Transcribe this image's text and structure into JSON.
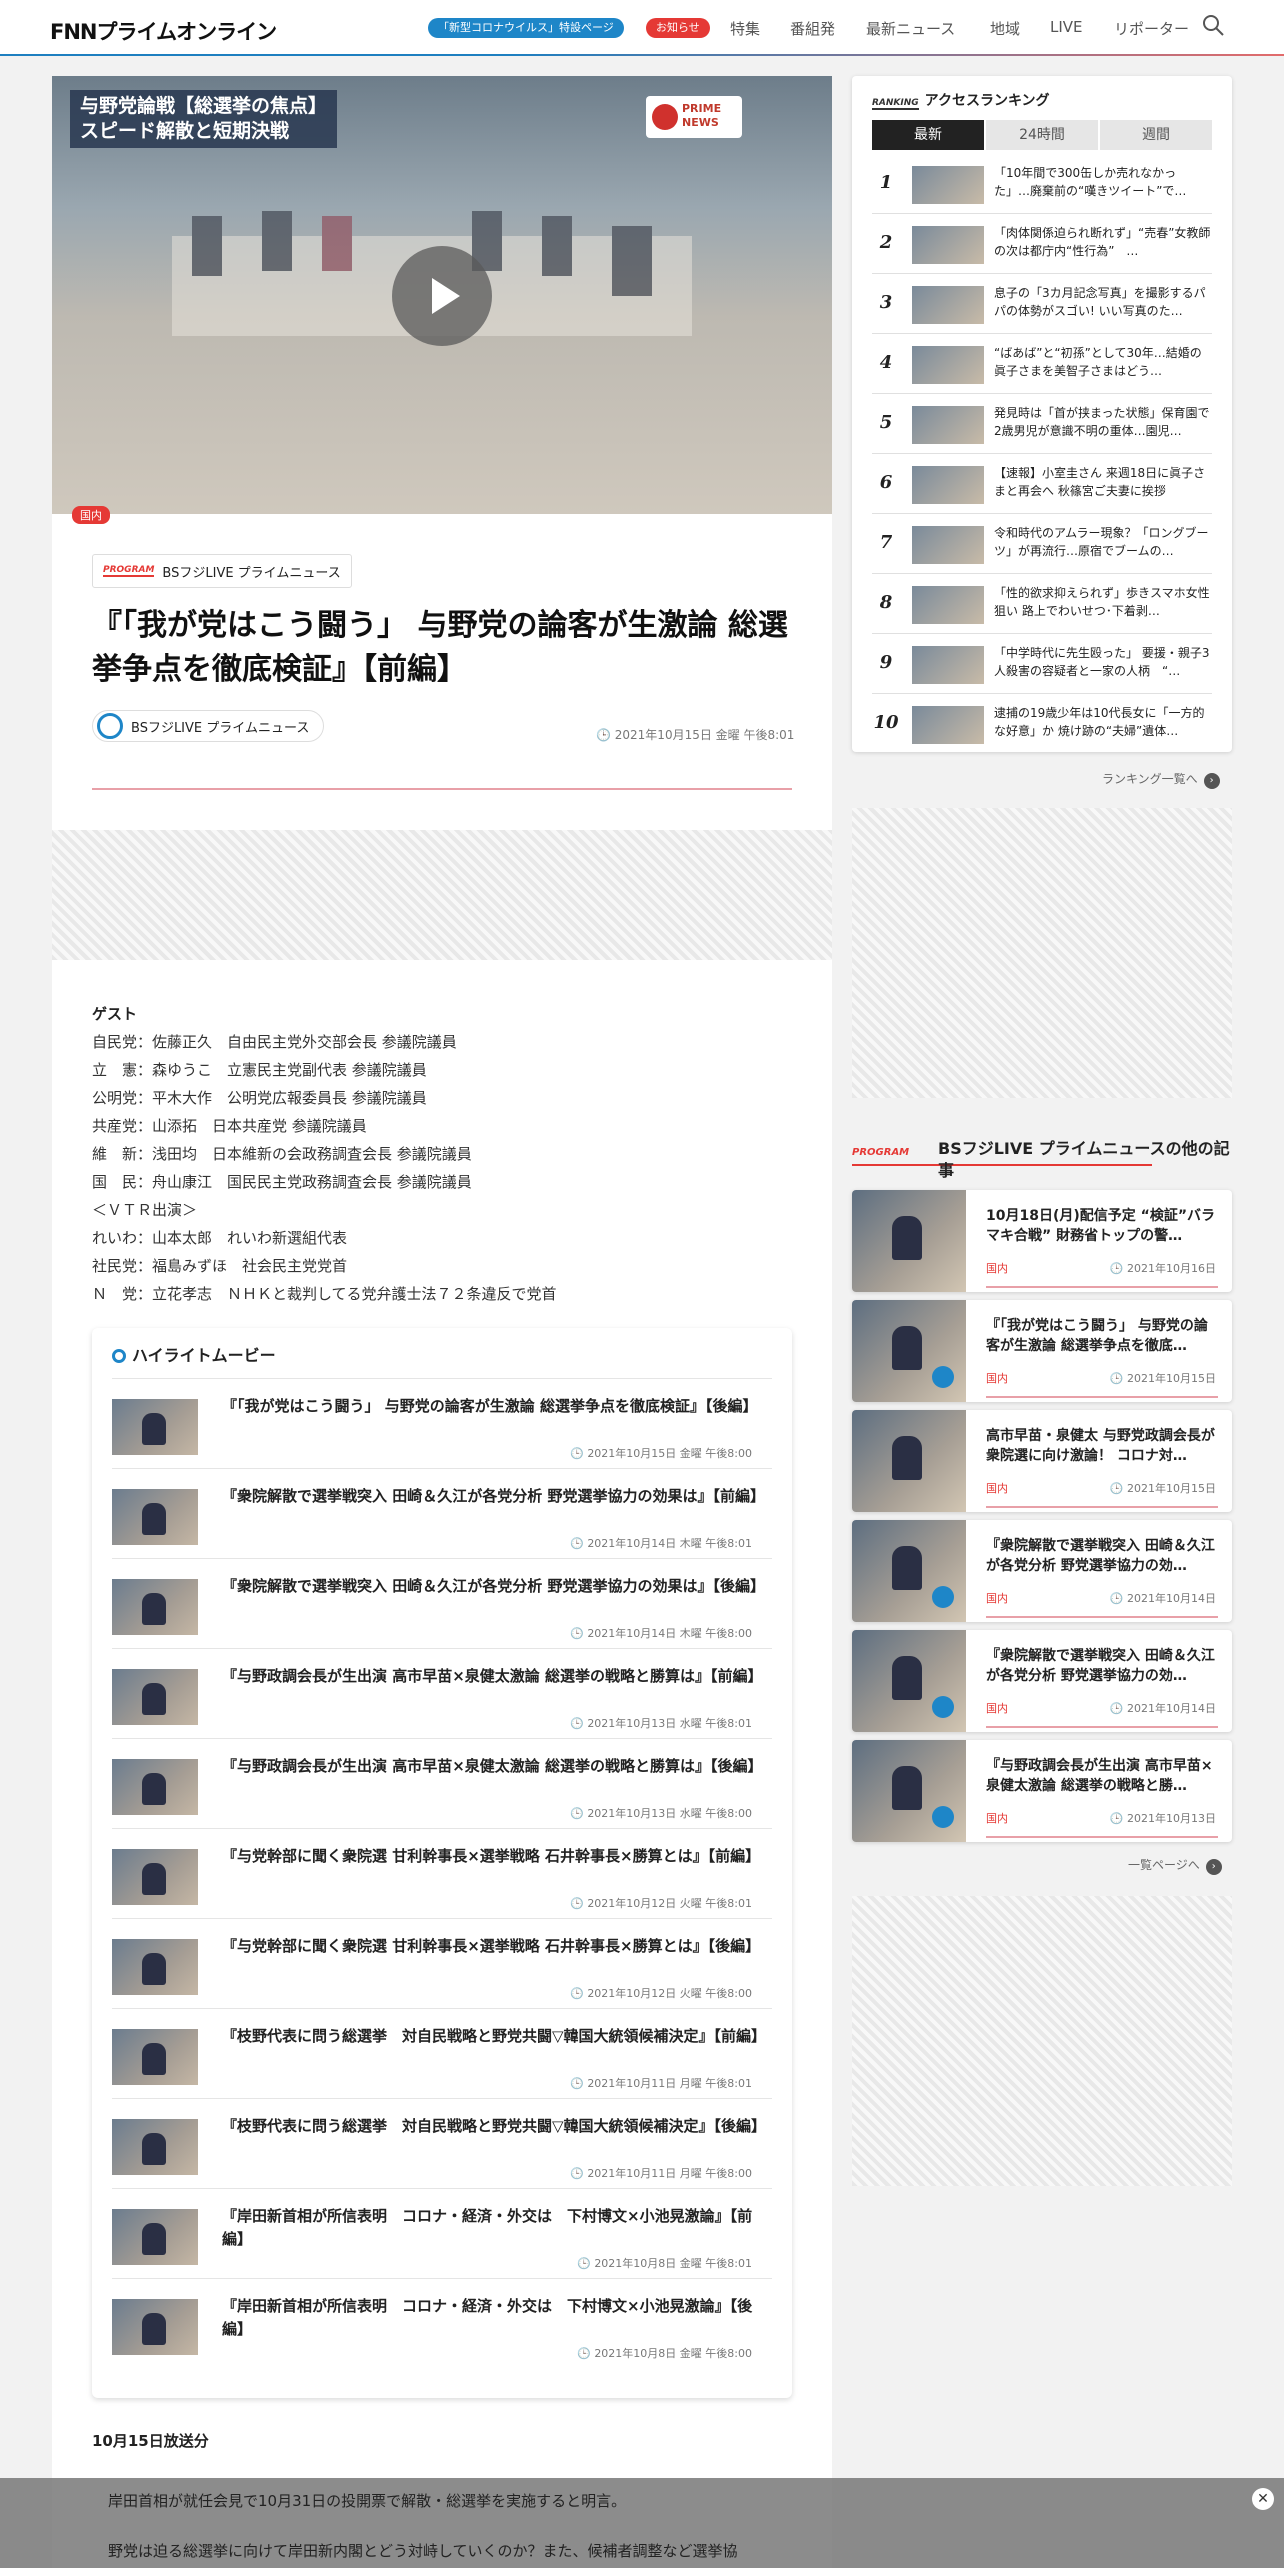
{
  "header": {
    "logo": "FNNプライムオンライン",
    "corona_pill": "「新型コロナウイルス」特設ページ",
    "notice_pill": "お知らせ",
    "nav": [
      "特集",
      "番組発",
      "最新ニュース",
      "地域",
      "LIVE",
      "リポーター"
    ]
  },
  "hero": {
    "caption_line1": "与野党論戦【総選挙の焦点】",
    "caption_line2": "スピード解散と短期決戦",
    "brand_badge": "PRIME NEWS",
    "category_tag": "国内"
  },
  "article": {
    "program_mark": "PROGRAM",
    "program_name": "BSフジLIVE プライムニュース",
    "title": "『「我が党はこう闘う」 与野党の論客が生激論 総選挙争点を徹底検証』【前編】",
    "author": "BSフジLIVE プライムニュース",
    "date": "2021年10月15日 金曜 午後8:01",
    "guest_heading": "ゲスト",
    "guests": [
      "自民党：佐藤正久　自由民主党外交部会長 参議院議員",
      "立　憲：森ゆうこ　立憲民主党副代表 参議院議員",
      "公明党：平木大作　公明党広報委員長 参議院議員",
      "共産党：山添拓　日本共産党 参議院議員",
      "維　新：浅田均　日本維新の会政務調査会長 参議院議員",
      "国　民：舟山康江　国民民主党政務調査会長 参議院議員",
      "＜ＶＴＲ出演＞",
      "れいわ：山本太郎　れいわ新選組代表",
      "社民党：福島みずほ　社会民主党党首",
      "Ｎ　党：立花孝志　ＮＨＫと裁判してる党弁護士法７２条違反で党首"
    ],
    "broadcast_heading": "10月15日放送分",
    "para1": "岸田首相が就任会見で10月31日の投開票で解散・総選挙を実施すると明言。",
    "para2": "野党は迫る総選挙に向けて岸田新内閣とどう対峙していくのか？また、候補者調整など選挙協"
  },
  "highlight": {
    "heading": "ハイライトムービー",
    "items": [
      {
        "title": "『「我が党はこう闘う」 与野党の論客が生激論 総選挙争点を徹底検証』【後編】",
        "date": "2021年10月15日 金曜 午後8:00"
      },
      {
        "title": "『衆院解散で選挙戦突入 田崎＆久江が各党分析 野党選挙協力の効果は』【前編】",
        "date": "2021年10月14日 木曜 午後8:01"
      },
      {
        "title": "『衆院解散で選挙戦突入 田崎＆久江が各党分析 野党選挙協力の効果は』【後編】",
        "date": "2021年10月14日 木曜 午後8:00"
      },
      {
        "title": "『与野政調会長が生出演 高市早苗×泉健太激論 総選挙の戦略と勝算は』【前編】",
        "date": "2021年10月13日 水曜 午後8:01"
      },
      {
        "title": "『与野政調会長が生出演 高市早苗×泉健太激論 総選挙の戦略と勝算は』【後編】",
        "date": "2021年10月13日 水曜 午後8:00"
      },
      {
        "title": "『与党幹部に聞く衆院選 甘利幹事長×選挙戦略 石井幹事長×勝算とは』【前編】",
        "date": "2021年10月12日 火曜 午後8:01"
      },
      {
        "title": "『与党幹部に聞く衆院選 甘利幹事長×選挙戦略 石井幹事長×勝算とは』【後編】",
        "date": "2021年10月12日 火曜 午後8:00"
      },
      {
        "title": "『枝野代表に問う総選挙　対自民戦略と野党共闘▽韓国大統領候補決定』【前編】",
        "date": "2021年10月11日 月曜 午後8:01"
      },
      {
        "title": "『枝野代表に問う総選挙　対自民戦略と野党共闘▽韓国大統領候補決定』【後編】",
        "date": "2021年10月11日 月曜 午後8:00"
      },
      {
        "title": "『岸田新首相が所信表明　コロナ・経済・外交は　下村博文×小池晃激論』【前編】",
        "date": "2021年10月8日 金曜 午後8:01"
      },
      {
        "title": "『岸田新首相が所信表明　コロナ・経済・外交は　下村博文×小池晃激論』【後編】",
        "date": "2021年10月8日 金曜 午後8:00"
      }
    ]
  },
  "ranking": {
    "mark": "RANKING",
    "heading": "アクセスランキング",
    "tabs": [
      "最新",
      "24時間",
      "週間"
    ],
    "items": [
      {
        "num": "1",
        "title": "「10年間で300缶しか売れなかった」…廃棄前の“嘆きツイート”で…"
      },
      {
        "num": "2",
        "title": "「肉体関係迫られ断れず」“売春”女教師の次は都庁内“性行為”　…"
      },
      {
        "num": "3",
        "title": "息子の「3カ月記念写真」を撮影するパパの体勢がスゴい! いい写真のた…"
      },
      {
        "num": "4",
        "title": "“ばあば”と“初孫”として30年…結婚の眞子さまを美智子さまはどう…"
      },
      {
        "num": "5",
        "title": "発見時は「首が挟まった状態」保育園で2歳男児が意識不明の重体…園児…"
      },
      {
        "num": "6",
        "title": "【速報】小室圭さん 来週18日に眞子さまと再会へ 秋篠宮ご夫妻に挨拶"
      },
      {
        "num": "7",
        "title": "令和時代のアムラー現象？「ロングブーツ」が再流行…原宿でブームの…"
      },
      {
        "num": "8",
        "title": "「性的欲求抑えられず」歩きスマホ女性狙い 路上でわいせつ･下着剥…"
      },
      {
        "num": "9",
        "title": "「中学時代に先生殴った」 要援・親子3人殺害の容疑者と一家の人柄　“…"
      },
      {
        "num": "10",
        "title": "逮捕の19歳少年は10代長女に「一方的な好意」か 焼け跡の“夫婦”遺体…"
      }
    ],
    "more": "ランキング一覧へ"
  },
  "other": {
    "heading": "BSフジLIVE プライムニュースの他の記事",
    "cards": [
      {
        "title": "10月18日(月)配信予定 “検証”バラマキ合戦” 財務省トップの警…",
        "tag": "国内",
        "date": "2021年10月16日"
      },
      {
        "title": "『「我が党はこう闘う」 与野党の論客が生激論 総選挙争点を徹底…",
        "tag": "国内",
        "date": "2021年10月15日"
      },
      {
        "title": "高市早苗・泉健太 与野党政調会長が衆院選に向け激論！ コロナ対…",
        "tag": "国内",
        "date": "2021年10月15日"
      },
      {
        "title": "『衆院解散で選挙戦突入 田崎＆久江が各党分析 野党選挙協力の効…",
        "tag": "国内",
        "date": "2021年10月14日"
      },
      {
        "title": "『衆院解散で選挙戦突入 田崎＆久江が各党分析 野党選挙協力の効…",
        "tag": "国内",
        "date": "2021年10月14日"
      },
      {
        "title": "『与野政調会長が生出演 高市早苗×泉健太激論 総選挙の戦略と勝…",
        "tag": "国内",
        "date": "2021年10月13日"
      }
    ],
    "more": "一覧ページへ"
  }
}
